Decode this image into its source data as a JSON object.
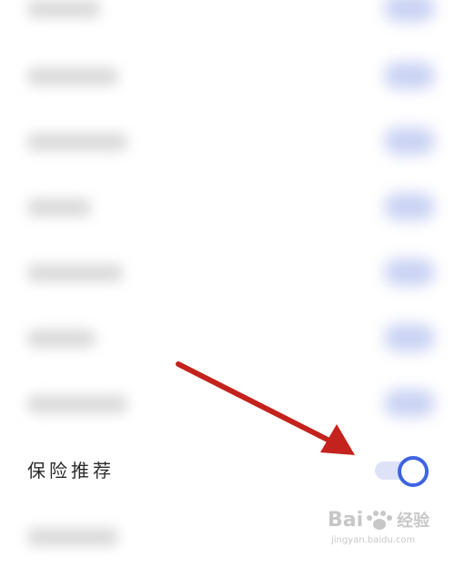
{
  "settings": {
    "highlighted_label": "保险推荐",
    "highlighted_toggle_on": true
  },
  "colors": {
    "toggle_accent": "#3f64e3",
    "toggle_track": "#dde2f8",
    "arrow": "#c3231c"
  },
  "watermark": {
    "brand_a": "Bai",
    "brand_b": "经验",
    "domain": "jingyan.baidu.com"
  }
}
